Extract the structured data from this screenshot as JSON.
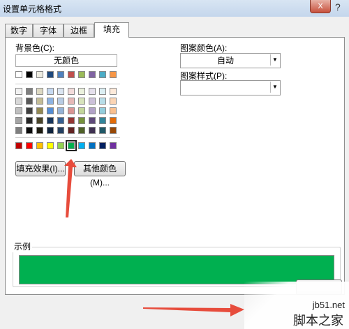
{
  "window": {
    "title": "设置单元格格式",
    "help_label": "?",
    "close_label": "X"
  },
  "tabs": [
    {
      "label": "数字"
    },
    {
      "label": "字体"
    },
    {
      "label": "边框"
    },
    {
      "label": "填充",
      "active": true
    }
  ],
  "fill": {
    "background_label": "背景色(C):",
    "no_color_label": "无颜色",
    "theme_row": [
      "#ffffff",
      "#000000",
      "#eeece1",
      "#1f497d",
      "#4f81bd",
      "#c0504d",
      "#9bbb59",
      "#8064a2",
      "#4bacc6",
      "#f79646"
    ],
    "tint_rows": [
      [
        "#f2f2f2",
        "#7f7f7f",
        "#ddd9c3",
        "#c6d9f0",
        "#dbe5f1",
        "#f2dcdb",
        "#ebf1dd",
        "#e5e0ec",
        "#dbeef3",
        "#fdeada"
      ],
      [
        "#d8d8d8",
        "#595959",
        "#c4bd97",
        "#8db3e2",
        "#b8cce4",
        "#e5b9b7",
        "#d7e3bc",
        "#ccc1d9",
        "#b7dde8",
        "#fbd5b5"
      ],
      [
        "#bfbfbf",
        "#3f3f3f",
        "#938953",
        "#548dd4",
        "#95b3d7",
        "#d99694",
        "#c3d69b",
        "#b2a2c7",
        "#92cddc",
        "#fac08f"
      ],
      [
        "#a5a5a5",
        "#262626",
        "#494429",
        "#17365d",
        "#366092",
        "#953734",
        "#76923c",
        "#5f497a",
        "#31859b",
        "#e36c09"
      ],
      [
        "#7f7f7f",
        "#0c0c0c",
        "#1d1b10",
        "#0f243e",
        "#244061",
        "#632423",
        "#4f6128",
        "#3f3151",
        "#205867",
        "#974806"
      ]
    ],
    "standard_row": [
      "#c00000",
      "#ff0000",
      "#ffc000",
      "#ffff00",
      "#92d050",
      "#00b050",
      "#00b0f0",
      "#0070c0",
      "#002060",
      "#7030a0"
    ],
    "selected_color": "#00b050",
    "fill_effects_button": "填充效果(I)...",
    "more_colors_button": "其他颜色(M)...",
    "pattern_color_label": "图案颜色(A):",
    "pattern_color_value": "自动",
    "pattern_style_label": "图案样式(P):",
    "pattern_style_value": "",
    "sample_label": "示例"
  },
  "watermark": {
    "line1": "jb51.net",
    "line2": "脚本之家"
  }
}
